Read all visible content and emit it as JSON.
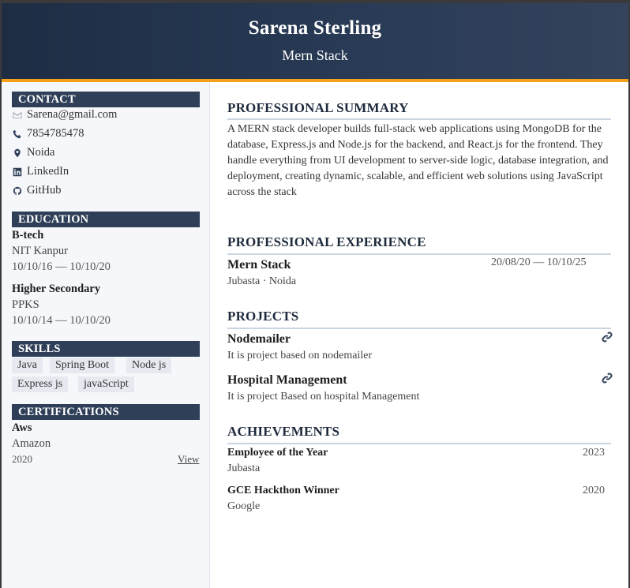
{
  "header": {
    "name": "Sarena Sterling",
    "role": "Mern Stack"
  },
  "contact": {
    "title": "CONTACT",
    "email": "Sarena@gmail.com",
    "phone": "7854785478",
    "location": "Noida",
    "linkedin": "LinkedIn",
    "github": "GitHub"
  },
  "education": {
    "title": "EDUCATION",
    "items": [
      {
        "degree": "B-tech",
        "school": "NIT Kanpur",
        "dates": "10/10/16 — 10/10/20"
      },
      {
        "degree": "Higher Secondary",
        "school": "PPKS",
        "dates": "10/10/14 — 10/10/20"
      }
    ]
  },
  "skills": {
    "title": "SKILLS",
    "items": [
      "Java",
      "Spring Boot",
      "Node js",
      "Express js",
      "javaScript"
    ]
  },
  "certifications": {
    "title": "CERTIFICATIONS",
    "items": [
      {
        "name": "Aws",
        "issuer": "Amazon",
        "year": "2020",
        "link_label": "View"
      }
    ]
  },
  "summary": {
    "title": "PROFESSIONAL SUMMARY",
    "text": "A MERN stack developer builds full-stack web applications using MongoDB for the database, Express.js and Node.js for the backend, and React.js for the frontend. They handle everything from UI development to server-side logic, database integration, and deployment, creating dynamic, scalable, and efficient web solutions using JavaScript across the stack"
  },
  "experience": {
    "title": "PROFESSIONAL EXPERIENCE",
    "items": [
      {
        "role": "Mern Stack",
        "company": "Jubasta · Noida",
        "dates": "20/08/20 — 10/10/25"
      }
    ]
  },
  "projects": {
    "title": "PROJECTS",
    "items": [
      {
        "name": "Nodemailer",
        "desc": "It is project based on nodemailer"
      },
      {
        "name": "Hospital Management",
        "desc": "It is project Based on hospital Management"
      }
    ]
  },
  "achievements": {
    "title": "ACHIEVEMENTS",
    "items": [
      {
        "name": "Employee of the Year",
        "org": "Jubasta",
        "year": "2023"
      },
      {
        "name": "GCE Hackthon Winner",
        "org": "Google",
        "year": "2020"
      }
    ]
  }
}
